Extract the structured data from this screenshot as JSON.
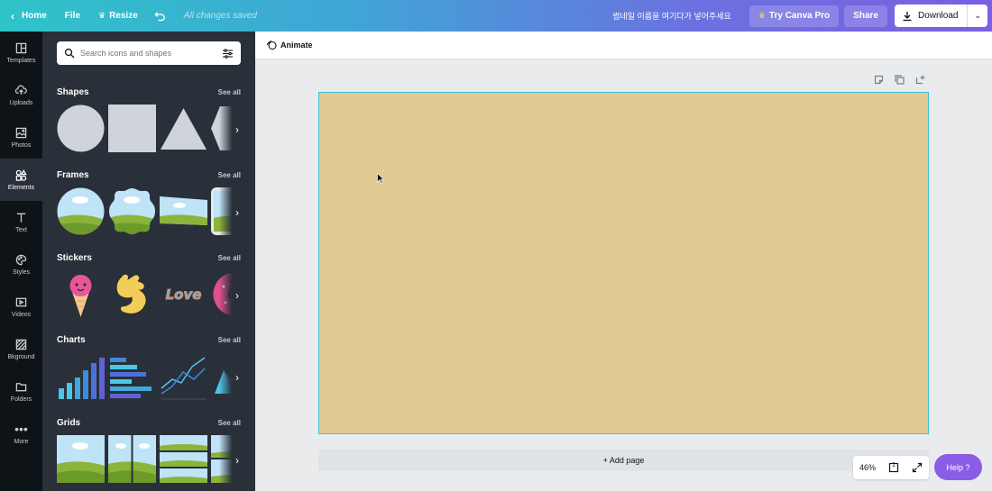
{
  "topbar": {
    "home": "Home",
    "file": "File",
    "resize": "Resize",
    "saved": "All changes saved",
    "title": "썸네일 이름을 여기다가 넣어주세요",
    "try_pro": "Try Canva Pro",
    "share": "Share",
    "download": "Download"
  },
  "rail": {
    "items": [
      "Templates",
      "Uploads",
      "Photos",
      "Elements",
      "Text",
      "Styles",
      "Videos",
      "Bkground",
      "Folders",
      "More"
    ]
  },
  "panel": {
    "search_placeholder": "Search icons and shapes",
    "see_all": "See all",
    "sections": [
      "Shapes",
      "Frames",
      "Stickers",
      "Charts",
      "Grids"
    ]
  },
  "main": {
    "animate": "Animate",
    "add_page": "+ Add page",
    "zoom": "46%",
    "page_count": "1",
    "help": "Help  ?"
  },
  "colors": {
    "canvas": "#e0cb92",
    "panel": "#293039",
    "rail": "#0e1318",
    "help": "#8b5ce6",
    "selection": "#3fc0d4"
  }
}
